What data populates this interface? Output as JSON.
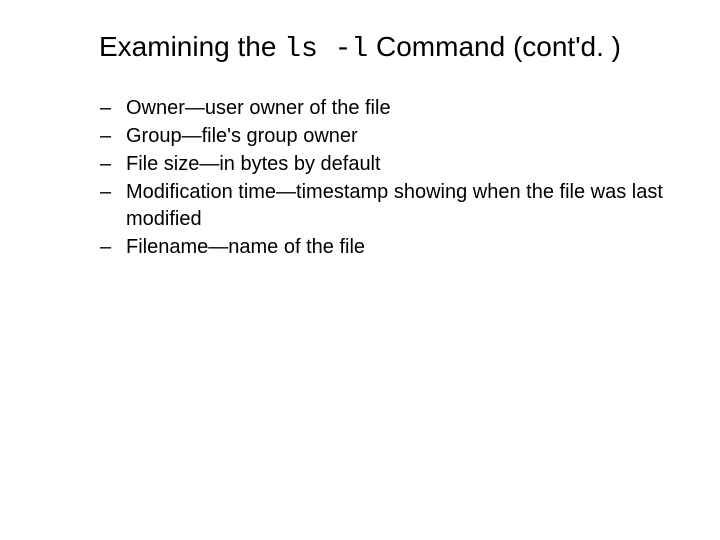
{
  "title": {
    "prefix": "Examining the ",
    "command": "ls -l",
    "suffix": " Command (cont'd. )"
  },
  "bullets": [
    "Owner—user owner of the file",
    "Group—file's group owner",
    "File size—in bytes by default",
    "Modification time—timestamp showing when the file was last modified",
    "Filename—name of the file"
  ],
  "dash": "–"
}
